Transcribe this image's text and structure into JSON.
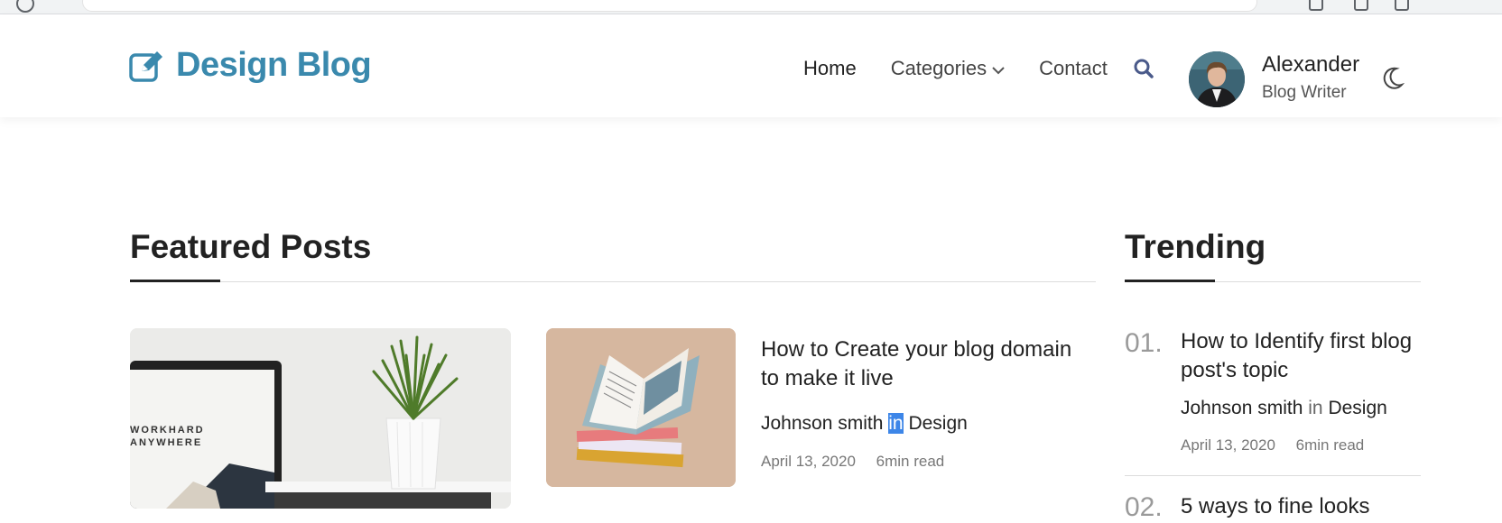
{
  "header": {
    "logo_text": "Design Blog",
    "nav": {
      "home": "Home",
      "categories": "Categories",
      "contact": "Contact"
    },
    "user": {
      "name": "Alexander",
      "role": "Blog Writer"
    }
  },
  "featured": {
    "title": "Featured Posts",
    "big_image_text_1": "WORKHARD",
    "big_image_text_2": "ANYWHERE",
    "post": {
      "title": "How to Create your blog domain to make it live",
      "author": "Johnson smith",
      "in": "in",
      "category": "Design",
      "date": "April 13, 2020",
      "read_time": "6min read"
    }
  },
  "trending": {
    "title": "Trending",
    "items": [
      {
        "number": "01.",
        "title": "How to Identify first blog post's topic",
        "author": "Johnson smith",
        "in": "in",
        "category": "Design",
        "date": "April 13, 2020",
        "read_time": "6min read"
      },
      {
        "number": "02.",
        "title": "5 ways to fine looks"
      }
    ]
  },
  "colors": {
    "brand": "#3a89ad",
    "selection": "#3d86e8",
    "nav_icon": "#4a5a8a"
  },
  "icons": [
    "edit-icon",
    "chevron-down-icon",
    "search-icon",
    "moon-icon"
  ]
}
